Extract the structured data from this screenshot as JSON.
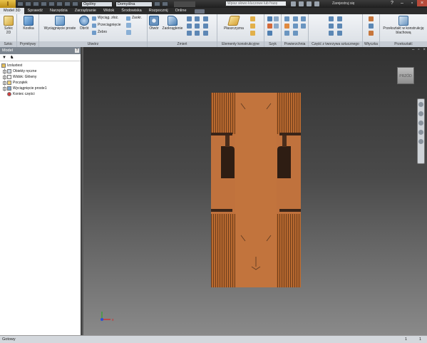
{
  "titlebar": {
    "style_combo": "Ogólny",
    "material_combo": "Domyślna",
    "dark_tag": "",
    "search_placeholder": "Wpisz słowo kluczowe lub frazę",
    "signin": "Zarejestruj się"
  },
  "tabs": [
    "Model 3D",
    "Sprawdź",
    "Narzędzia",
    "Zarządzanie",
    "Widok",
    "Środowiska",
    "Rozpocznij",
    "Online"
  ],
  "ribbon": {
    "panels": {
      "szkic": {
        "title": "Szkic",
        "btn": "Szkic 2D"
      },
      "prymitywy": {
        "title": "Prymitywy",
        "btn": "Kostka"
      },
      "utworz": {
        "title": "Utwórz",
        "big1": "Wyciągnięcie proste",
        "big2": "Obrót",
        "s1": "Wyciąg. złoż.",
        "s2": "Przeciągnięcie",
        "s3": "Żebro"
      },
      "zmien": {
        "title": "Zmień",
        "s1": "Zaokr.",
        "big1": "Otwór",
        "big2": "Zaokrąglenie"
      },
      "elementy": {
        "title": "Elementy konstrukcyjne",
        "btn": "Płaszczyzna"
      },
      "szyk": {
        "title": "Szyk"
      },
      "powierzchnia": {
        "title": "Powierzchnia"
      },
      "czesc": {
        "title": "Część z tworzywa sztucznego"
      },
      "wtyczka": {
        "title": "Wtyczka"
      },
      "przeksztalc": {
        "title": "Przekształć",
        "btn": "Przekształć w konstrukcję blachową"
      }
    }
  },
  "browser": {
    "title": "Model",
    "help": "?",
    "tools": {
      "filter": "▼",
      "find": "♞"
    },
    "tree": [
      "Izoluxtest",
      "Obiekty ręczne",
      "Widok: Główny",
      "Początek",
      "Wyciągnięcie proste1",
      "Koniec części"
    ]
  },
  "viewport": {
    "doc_controls": [
      "–",
      "▫",
      "×"
    ],
    "viewcube_label": "PRZÓD",
    "triad": {
      "x": "x",
      "y": "y"
    }
  },
  "statusbar": {
    "text": "Gotowy",
    "count1": "1",
    "count2": "1"
  },
  "colors": {
    "part_base": "#c0723d",
    "part_dark": "#3a2418",
    "ribbon_bg": "#e4e8ed"
  }
}
